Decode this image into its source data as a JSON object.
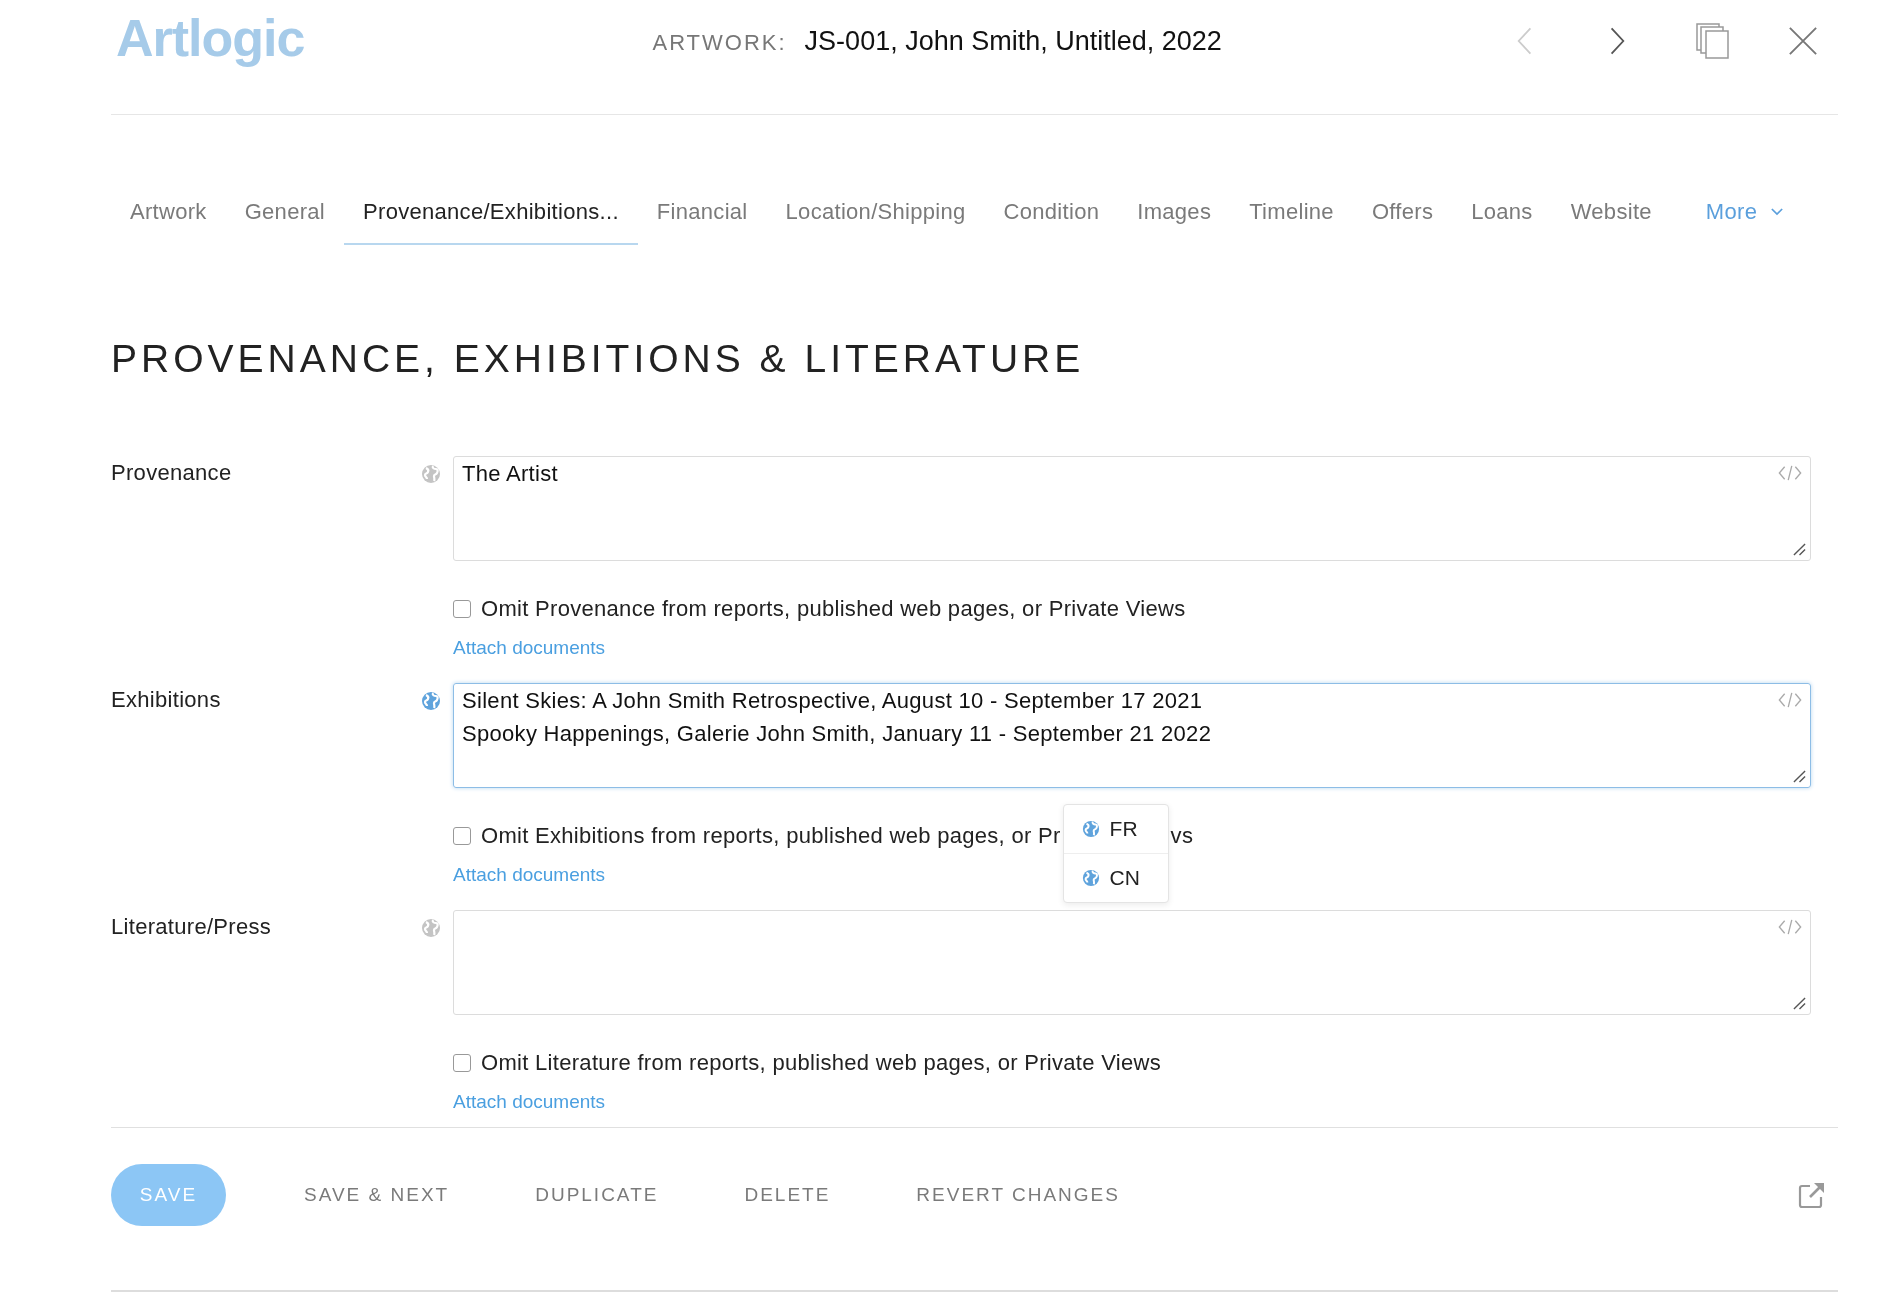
{
  "header": {
    "logo": "Artlogic",
    "record_label": "ARTWORK:",
    "record_title": "JS-001, John Smith, Untitled, 2022",
    "prev_disabled": true
  },
  "tabs": [
    {
      "label": "Artwork",
      "selected": false,
      "kind": "tab"
    },
    {
      "label": "General",
      "selected": false,
      "kind": "tab"
    },
    {
      "label": "Provenance/Exhibitions...",
      "selected": true,
      "kind": "tab"
    },
    {
      "label": "Financial",
      "selected": false,
      "kind": "tab"
    },
    {
      "label": "Location/Shipping",
      "selected": false,
      "kind": "tab"
    },
    {
      "label": "Condition",
      "selected": false,
      "kind": "tab"
    },
    {
      "label": "Images",
      "selected": false,
      "kind": "tab"
    },
    {
      "label": "Timeline",
      "selected": false,
      "kind": "tab"
    },
    {
      "label": "Offers",
      "selected": false,
      "kind": "tab"
    },
    {
      "label": "Loans",
      "selected": false,
      "kind": "tab"
    },
    {
      "label": "Website",
      "selected": false,
      "kind": "tab"
    },
    {
      "label": "More",
      "selected": false,
      "kind": "menu"
    }
  ],
  "section_title": "PROVENANCE, EXHIBITIONS & LITERATURE",
  "fields": [
    {
      "label": "Provenance",
      "focused": false,
      "value": "The Artist",
      "omit": {
        "checked": false,
        "text_parts": [
          "Omit Provenance from reports, published web pages, or Private Views"
        ]
      },
      "attach": "Attach documents"
    },
    {
      "label": "Exhibitions",
      "focused": true,
      "value": "Silent Skies: A John Smith Retrospective, August 10 - September 17 2021\nSpooky Happenings, Galerie John Smith, January 11 - September 21 2022",
      "omit": {
        "checked": false,
        "text_parts": [
          "Omit Exhibitions from reports, published web pages, or Pr",
          "vs"
        ]
      },
      "attach": "Attach documents",
      "language_menu": [
        "FR",
        "CN"
      ]
    },
    {
      "label": "Literature/Press",
      "focused": false,
      "omit": {
        "checked": false,
        "text_parts": [
          "Omit Literature from reports, published web pages, or Private Views"
        ]
      },
      "attach": "Attach documents"
    }
  ],
  "footer_buttons": [
    {
      "label": "SAVE",
      "kind": "primary"
    },
    {
      "label": "SAVE & NEXT",
      "kind": "text"
    },
    {
      "label": "DUPLICATE",
      "kind": "text"
    },
    {
      "label": "DELETE",
      "kind": "text"
    },
    {
      "label": "REVERT CHANGES",
      "kind": "text"
    }
  ]
}
